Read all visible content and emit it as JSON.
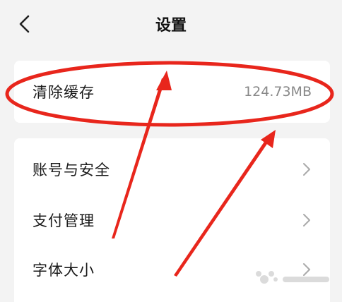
{
  "header": {
    "title": "设置",
    "back_icon": "chevron-left-icon"
  },
  "cache_card": {
    "label": "清除缓存",
    "value": "124.73MB"
  },
  "settings_list": {
    "items": [
      {
        "label": "账号与安全",
        "icon": "chevron-right-icon"
      },
      {
        "label": "支付管理",
        "icon": "chevron-right-icon"
      },
      {
        "label": "字体大小",
        "icon": "chevron-right-icon"
      }
    ]
  },
  "annotation": {
    "color": "#e8261c"
  }
}
